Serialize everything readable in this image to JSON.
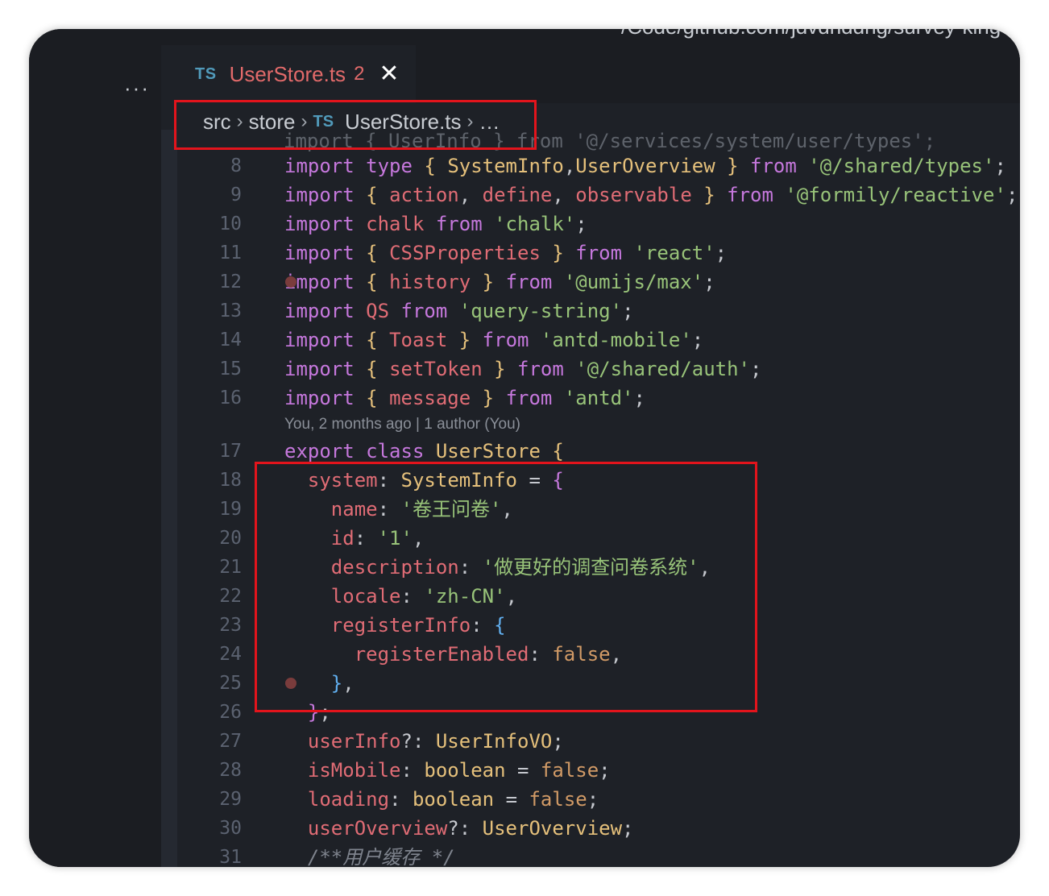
{
  "window": {
    "top_path": "/Code/github.com/jdvdnddng/survey-king",
    "more_label": "···"
  },
  "tab": {
    "lang_badge": "TS",
    "title": "UserStore.ts",
    "problems_count": "2",
    "close_symbol": "✕"
  },
  "breadcrumb": {
    "items": [
      "src",
      "store",
      "UserStore.ts",
      "…"
    ],
    "lang_badge": "TS",
    "separator": "›"
  },
  "editor": {
    "peek_line": "import { UserInfo } from '@/services/system/user/types';",
    "blame": "You, 2 months ago | 1 author (You)",
    "lines": [
      {
        "n": "8",
        "tokens": [
          [
            "kw",
            "import "
          ],
          [
            "kw",
            "type "
          ],
          [
            "p1",
            "{ "
          ],
          [
            "cl",
            "SystemInfo"
          ],
          [
            "",
            ","
          ],
          [
            "cl",
            "UserOverview "
          ],
          [
            "p1",
            "} "
          ],
          [
            "kw",
            "from "
          ],
          [
            "st",
            "'@/shared/types'"
          ],
          [
            "",
            ";"
          ]
        ]
      },
      {
        "n": "9",
        "tokens": [
          [
            "kw",
            "import "
          ],
          [
            "p1",
            "{ "
          ],
          [
            "pr",
            "action"
          ],
          [
            "",
            ", "
          ],
          [
            "pr",
            "define"
          ],
          [
            "",
            ", "
          ],
          [
            "pr",
            "observable "
          ],
          [
            "p1",
            "} "
          ],
          [
            "kw",
            "from "
          ],
          [
            "st",
            "'@formily/reactive'"
          ],
          [
            "",
            ";"
          ]
        ]
      },
      {
        "n": "10",
        "tokens": [
          [
            "kw",
            "import "
          ],
          [
            "pr",
            "chalk "
          ],
          [
            "kw",
            "from "
          ],
          [
            "st",
            "'chalk'"
          ],
          [
            "",
            ";"
          ]
        ]
      },
      {
        "n": "11",
        "tokens": [
          [
            "kw",
            "import "
          ],
          [
            "p1",
            "{ "
          ],
          [
            "pr",
            "CSSProperties "
          ],
          [
            "p1",
            "} "
          ],
          [
            "kw",
            "from "
          ],
          [
            "st",
            "'react'"
          ],
          [
            "",
            ";"
          ]
        ]
      },
      {
        "n": "12",
        "tokens": [
          [
            "kw",
            "import "
          ],
          [
            "p1",
            "{ "
          ],
          [
            "pr",
            "history "
          ],
          [
            "p1",
            "} "
          ],
          [
            "kw",
            "from "
          ],
          [
            "st",
            "'@umijs/max'"
          ],
          [
            "",
            ";"
          ]
        ]
      },
      {
        "n": "13",
        "tokens": [
          [
            "kw",
            "import "
          ],
          [
            "pr",
            "QS "
          ],
          [
            "kw",
            "from "
          ],
          [
            "st",
            "'query-string'"
          ],
          [
            "",
            ";"
          ]
        ]
      },
      {
        "n": "14",
        "tokens": [
          [
            "kw",
            "import "
          ],
          [
            "p1",
            "{ "
          ],
          [
            "pr",
            "Toast "
          ],
          [
            "p1",
            "} "
          ],
          [
            "kw",
            "from "
          ],
          [
            "st",
            "'antd-mobile'"
          ],
          [
            "",
            ";"
          ]
        ]
      },
      {
        "n": "15",
        "tokens": [
          [
            "kw",
            "import "
          ],
          [
            "p1",
            "{ "
          ],
          [
            "pr",
            "setToken "
          ],
          [
            "p1",
            "} "
          ],
          [
            "kw",
            "from "
          ],
          [
            "st",
            "'@/shared/auth'"
          ],
          [
            "",
            ";"
          ]
        ]
      },
      {
        "n": "16",
        "tokens": [
          [
            "kw",
            "import "
          ],
          [
            "p1",
            "{ "
          ],
          [
            "pr",
            "message "
          ],
          [
            "p1",
            "} "
          ],
          [
            "kw",
            "from "
          ],
          [
            "st",
            "'antd'"
          ],
          [
            "",
            ";"
          ]
        ]
      },
      {
        "blame": true
      },
      {
        "n": "17",
        "tokens": [
          [
            "kw",
            "export "
          ],
          [
            "kw",
            "class "
          ],
          [
            "cl",
            "UserStore "
          ],
          [
            "p1",
            "{"
          ]
        ]
      },
      {
        "n": "18",
        "tokens": [
          [
            "",
            "  "
          ],
          [
            "pr",
            "system"
          ],
          [
            "",
            ": "
          ],
          [
            "cl",
            "SystemInfo "
          ],
          [
            "",
            "= "
          ],
          [
            "p2",
            "{"
          ]
        ]
      },
      {
        "n": "19",
        "tokens": [
          [
            "",
            "    "
          ],
          [
            "pr",
            "name"
          ],
          [
            "",
            ": "
          ],
          [
            "st",
            "'卷王问卷'"
          ],
          [
            "",
            ","
          ]
        ]
      },
      {
        "n": "20",
        "tokens": [
          [
            "",
            "    "
          ],
          [
            "pr",
            "id"
          ],
          [
            "",
            ": "
          ],
          [
            "st",
            "'1'"
          ],
          [
            "",
            ","
          ]
        ]
      },
      {
        "n": "21",
        "tokens": [
          [
            "",
            "    "
          ],
          [
            "pr",
            "description"
          ],
          [
            "",
            ": "
          ],
          [
            "st",
            "'做更好的调查问卷系统'"
          ],
          [
            "",
            ","
          ]
        ]
      },
      {
        "n": "22",
        "tokens": [
          [
            "",
            "    "
          ],
          [
            "pr",
            "locale"
          ],
          [
            "",
            ": "
          ],
          [
            "st",
            "'zh-CN'"
          ],
          [
            "",
            ","
          ]
        ]
      },
      {
        "n": "23",
        "tokens": [
          [
            "",
            "    "
          ],
          [
            "pr",
            "registerInfo"
          ],
          [
            "",
            ": "
          ],
          [
            "p3",
            "{"
          ]
        ]
      },
      {
        "n": "24",
        "tokens": [
          [
            "",
            "      "
          ],
          [
            "pr",
            "registerEnabled"
          ],
          [
            "",
            ": "
          ],
          [
            "nu",
            "false"
          ],
          [
            "",
            ","
          ]
        ]
      },
      {
        "n": "25",
        "tokens": [
          [
            "",
            "    "
          ],
          [
            "p3",
            "}"
          ],
          [
            "",
            ","
          ]
        ]
      },
      {
        "n": "26",
        "tokens": [
          [
            "",
            "  "
          ],
          [
            "p2",
            "}"
          ],
          [
            "",
            ";"
          ]
        ]
      },
      {
        "n": "27",
        "tokens": [
          [
            "",
            "  "
          ],
          [
            "pr",
            "userInfo"
          ],
          [
            "",
            "?: "
          ],
          [
            "cl",
            "UserInfoVO"
          ],
          [
            "",
            ";"
          ]
        ]
      },
      {
        "n": "28",
        "tokens": [
          [
            "",
            "  "
          ],
          [
            "pr",
            "isMobile"
          ],
          [
            "",
            ": "
          ],
          [
            "cl",
            "boolean "
          ],
          [
            "",
            "= "
          ],
          [
            "nu",
            "false"
          ],
          [
            "",
            ";"
          ]
        ]
      },
      {
        "n": "29",
        "tokens": [
          [
            "",
            "  "
          ],
          [
            "pr",
            "loading"
          ],
          [
            "",
            ": "
          ],
          [
            "cl",
            "boolean "
          ],
          [
            "",
            "= "
          ],
          [
            "nu",
            "false"
          ],
          [
            "",
            ";"
          ]
        ]
      },
      {
        "n": "30",
        "tokens": [
          [
            "",
            "  "
          ],
          [
            "pr",
            "userOverview"
          ],
          [
            "",
            "?: "
          ],
          [
            "cl",
            "UserOverview"
          ],
          [
            "",
            ";"
          ]
        ]
      },
      {
        "n": "31",
        "tokens": [
          [
            "",
            "  "
          ],
          [
            "cm",
            "/**用户缓存 */"
          ]
        ]
      }
    ]
  },
  "breakpoints": [
    {
      "line": "12"
    },
    {
      "line": "25"
    }
  ],
  "colors": {
    "highlight_box": "#e3141c",
    "editor_bg": "#1e2127",
    "ts_badge": "#519aba",
    "tab_error": "#e26a6a"
  }
}
